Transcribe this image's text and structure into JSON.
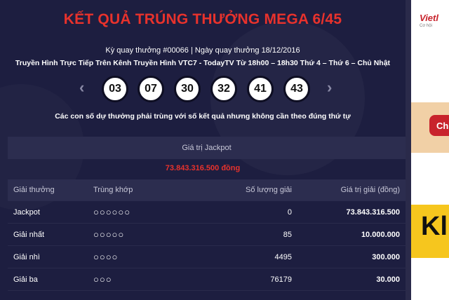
{
  "title": "KẾT QUẢ TRÚNG THƯỞNG MEGA 6/45",
  "draw_info": "Kỳ quay thưởng #00066 | Ngày quay thưởng 18/12/2016",
  "broadcast_info": "Truyền Hình Trực Tiếp Trên Kênh Truyền Hình VTC7 - TodayTV Từ 18h00 – 18h30 Thứ 4 – Thứ 6 – Chủ Nhật",
  "numbers": [
    "03",
    "07",
    "30",
    "32",
    "41",
    "43"
  ],
  "note": "Các con số dự thưởng phải trùng với số kết quả nhưng không cần theo đúng thứ tự",
  "jackpot": {
    "label": "Giá trị Jackpot",
    "value": "73.843.316.500 đồng"
  },
  "table": {
    "headers": [
      "Giải thưởng",
      "Trùng khớp",
      "Số lượng giải",
      "Giá trị giải (đồng)"
    ],
    "rows": [
      {
        "prize": "Jackpot",
        "match": "○○○○○○",
        "count": "0",
        "value": "73.843.316.500"
      },
      {
        "prize": "Giải nhất",
        "match": "○○○○○",
        "count": "85",
        "value": "10.000.000"
      },
      {
        "prize": "Giải nhì",
        "match": "○○○○",
        "count": "4495",
        "value": "300.000"
      },
      {
        "prize": "Giải ba",
        "match": "○○○",
        "count": "76179",
        "value": "30.000"
      }
    ]
  },
  "ad": {
    "brand": "Vietl",
    "small": "Cơ hội",
    "button": "Ch",
    "big_letter": "Kl"
  },
  "nav": {
    "prev": "‹",
    "next": "›"
  }
}
